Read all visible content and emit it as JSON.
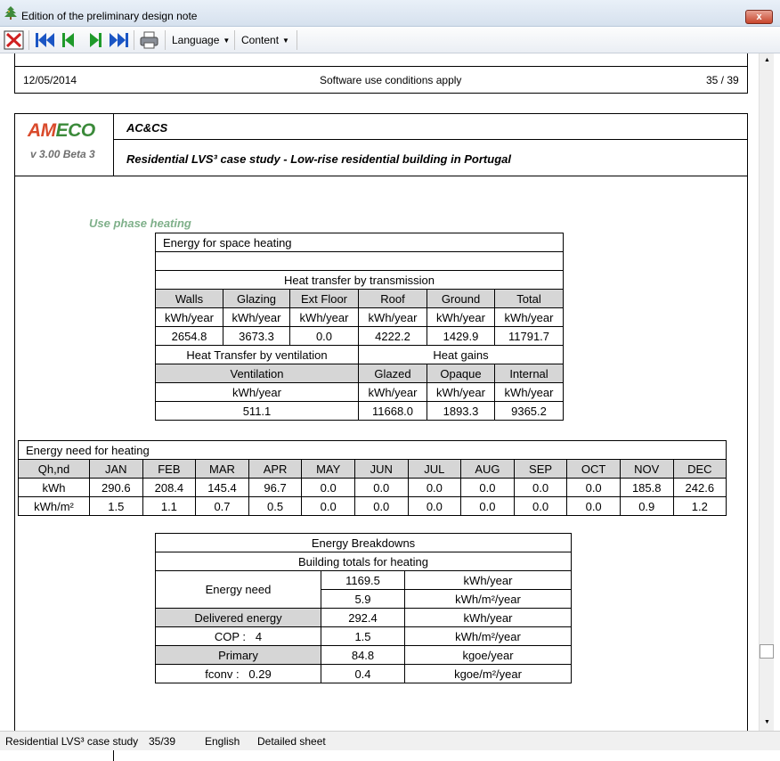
{
  "window": {
    "title": "Edition of the preliminary design note",
    "close": "x"
  },
  "toolbar": {
    "language": "Language",
    "content": "Content"
  },
  "page_top": {
    "date": "12/05/2014",
    "notice": "Software use conditions apply",
    "page": "35 / 39"
  },
  "header": {
    "logo_a": "AM",
    "logo_b": "ECO",
    "version": "v 3.00 Beta 3",
    "company": "AC&CS",
    "project": "Residential LVS³ case study - Low-rise residential building in Portugal"
  },
  "section_title": "Use phase heating",
  "space_heating": {
    "title": "Energy for space heating",
    "transmission_title": "Heat transfer by transmission",
    "headers": [
      "Walls",
      "Glazing",
      "Ext Floor",
      "Roof",
      "Ground",
      "Total"
    ],
    "units": [
      "kWh/year",
      "kWh/year",
      "kWh/year",
      "kWh/year",
      "kWh/year",
      "kWh/year"
    ],
    "values": [
      "2654.8",
      "3673.3",
      "0.0",
      "4222.2",
      "1429.9",
      "11791.7"
    ],
    "ventilation_title": "Heat Transfer by ventilation",
    "gains_title": "Heat gains",
    "ventilation_header": "Ventilation",
    "gain_headers": [
      "Glazed",
      "Opaque",
      "Internal"
    ],
    "ventilation_unit": "kWh/year",
    "gain_units": [
      "kWh/year",
      "kWh/year",
      "kWh/year"
    ],
    "ventilation_value": "511.1",
    "gain_values": [
      "11668.0",
      "1893.3",
      "9365.2"
    ]
  },
  "energy_need": {
    "title": "Energy need for heating",
    "corner": "Qh,nd",
    "months": [
      "JAN",
      "FEB",
      "MAR",
      "APR",
      "MAY",
      "JUN",
      "JUL",
      "AUG",
      "SEP",
      "OCT",
      "NOV",
      "DEC"
    ],
    "row1_label": "kWh",
    "row1": [
      "290.6",
      "208.4",
      "145.4",
      "96.7",
      "0.0",
      "0.0",
      "0.0",
      "0.0",
      "0.0",
      "0.0",
      "185.8",
      "242.6"
    ],
    "row2_label": "kWh/m²",
    "row2": [
      "1.5",
      "1.1",
      "0.7",
      "0.5",
      "0.0",
      "0.0",
      "0.0",
      "0.0",
      "0.0",
      "0.0",
      "0.9",
      "1.2"
    ]
  },
  "breakdown": {
    "title": "Energy Breakdowns",
    "subtitle": "Building totals for heating",
    "need_label": "Energy need",
    "need_v1": "1169.5",
    "need_u1": "kWh/year",
    "need_v2": "5.9",
    "need_u2": "kWh/m²/year",
    "delivered_label": "Delivered energy",
    "delivered_v": "292.4",
    "delivered_u": "kWh/year",
    "cop_label": "COP :   4",
    "cop_v": "1.5",
    "cop_u": "kWh/m²/year",
    "primary_label": "Primary",
    "primary_v": "84.8",
    "primary_u": "kgoe/year",
    "fconv_label": "fconv :   0.29",
    "fconv_v": "0.4",
    "fconv_u": "kgoe/m²/year"
  },
  "status": {
    "doc": "Residential LVS³ case study",
    "page": "35/39",
    "lang": "English",
    "mode": "Detailed sheet"
  }
}
